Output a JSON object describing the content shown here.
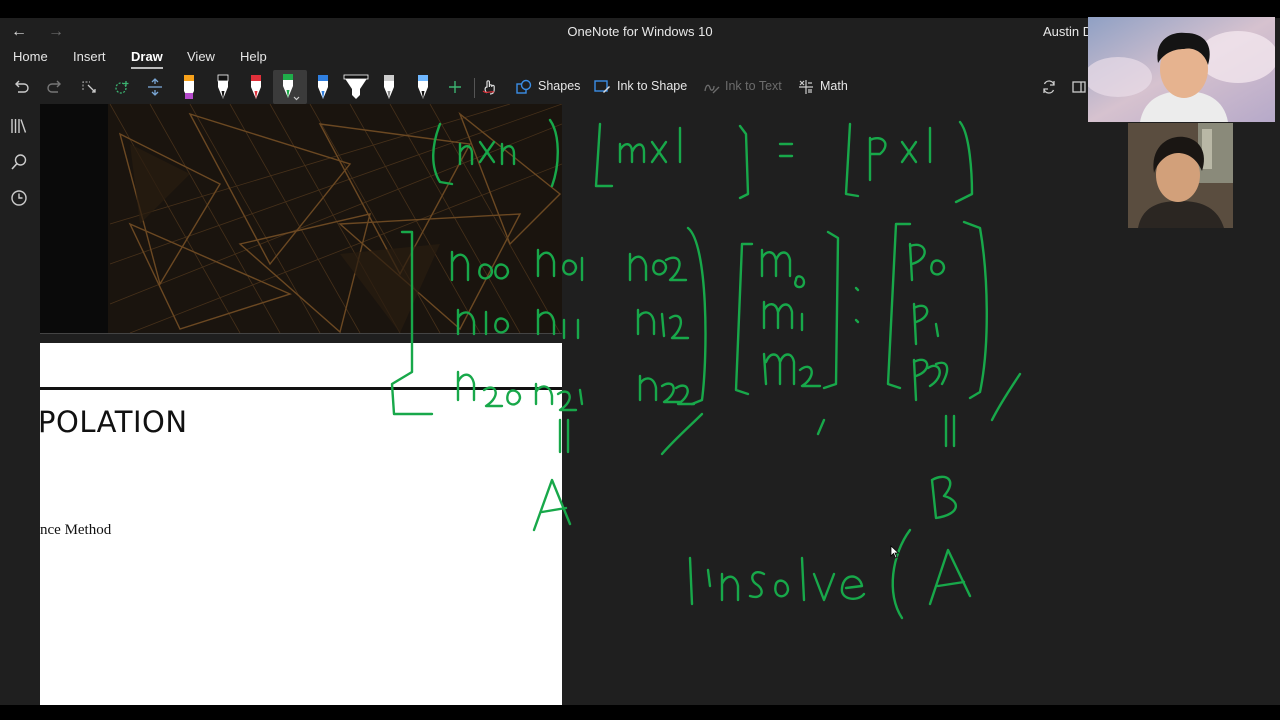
{
  "window": {
    "title": "OneNote for Windows 10",
    "user": "Austin D"
  },
  "menu": {
    "home": "Home",
    "insert": "Insert",
    "draw": "Draw",
    "view": "View",
    "help": "Help"
  },
  "ribbon": {
    "shapes": "Shapes",
    "ink_to_shape": "Ink to Shape",
    "ink_to_text": "Ink to Text",
    "math": "Math",
    "pens": [
      {
        "name": "highlighter-orange",
        "color": "#f7a21b"
      },
      {
        "name": "pen-black",
        "color": "#111111"
      },
      {
        "name": "pen-red",
        "color": "#e0303a"
      },
      {
        "name": "pen-green",
        "color": "#1fae4a"
      },
      {
        "name": "pen-blue",
        "color": "#2f7fe0"
      },
      {
        "name": "highlighter-black",
        "color": "#111111"
      },
      {
        "name": "pencil-gray",
        "color": "#cccccc"
      },
      {
        "name": "pen-lightblue",
        "color": "#6fb7ff"
      }
    ]
  },
  "page": {
    "doc_heading": "POLATION",
    "doc_text": "nce Method"
  },
  "ink": {
    "color": "#18a84a"
  },
  "icons": [
    "back-icon",
    "forward-icon",
    "undo-icon",
    "redo-icon",
    "lasso-select-icon",
    "eraser-icon",
    "add-space-icon",
    "touch-draw-icon",
    "shapes-icon",
    "ink-to-shape-icon",
    "ink-to-text-icon",
    "math-icon",
    "sync-icon",
    "notebooks-icon",
    "search-icon",
    "recent-icon",
    "cursor-icon"
  ]
}
